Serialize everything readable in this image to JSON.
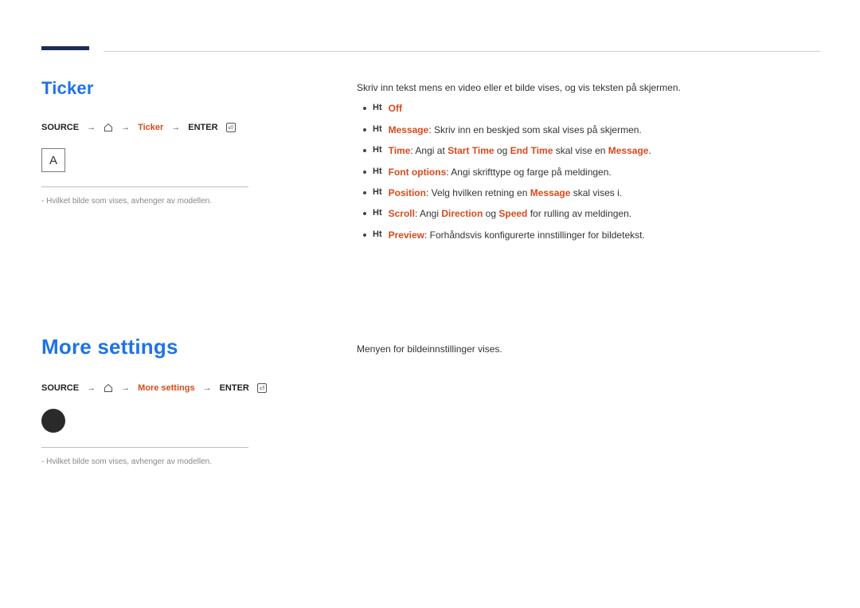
{
  "section1": {
    "title": "Ticker",
    "breadcrumb": {
      "src": "SOURCE",
      "mid": "Ticker",
      "end": "ENTER"
    },
    "thumb_letter": "A",
    "note": "- Hvilket bilde som vises, avhenger av modellen.",
    "intro": "Skriv inn tekst mens en video eller et bilde vises, og vis teksten på skjermen.",
    "items": {
      "off": "Off",
      "message_label": "Message",
      "message_text": ": Skriv inn en beskjed som skal vises på skjermen.",
      "time_label": "Time",
      "time_pre": ": Angi at ",
      "time_start": "Start Time",
      "time_og": " og ",
      "time_end": "End Time",
      "time_post": " skal vise en ",
      "time_msg": "Message",
      "font_label": "Font options",
      "font_text": ": Angi skrifttype og farge på meldingen.",
      "pos_label": "Position",
      "pos_pre": ": Velg hvilken retning en ",
      "pos_msg": "Message",
      "pos_post": " skal vises i.",
      "scroll_label": "Scroll",
      "scroll_pre": ": Angi ",
      "scroll_dir": "Direction",
      "scroll_og": " og ",
      "scroll_speed": "Speed",
      "scroll_post": " for rulling av meldingen.",
      "preview_label": "Preview",
      "preview_text": ": Forhåndsvis konfigurerte innstillinger for bildetekst."
    }
  },
  "section2": {
    "title": "More settings",
    "breadcrumb": {
      "src": "SOURCE",
      "mid": "More settings",
      "end": "ENTER"
    },
    "note": "- Hvilket bilde som vises, avhenger av modellen.",
    "body": "Menyen for bildeinnstillinger vises."
  }
}
